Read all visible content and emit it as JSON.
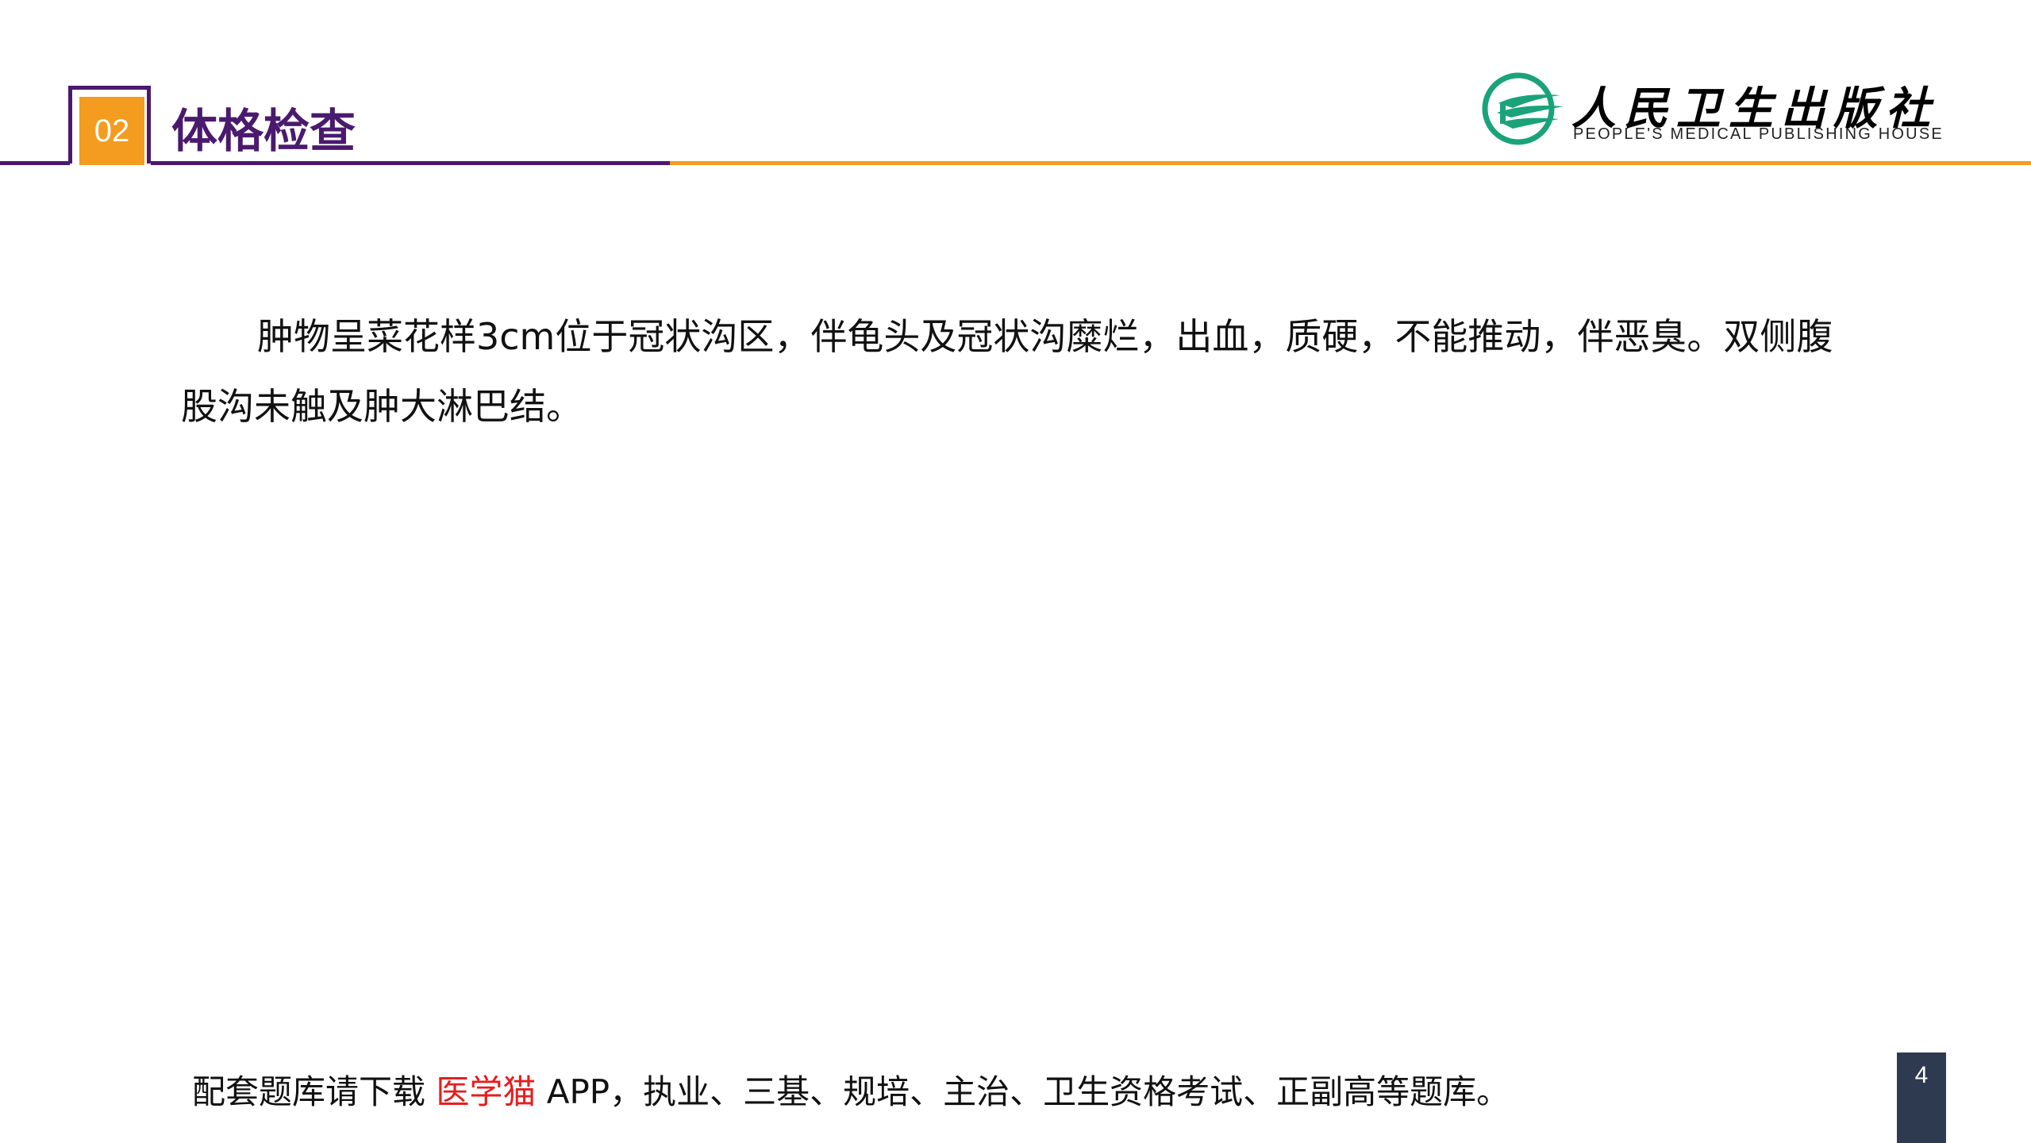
{
  "header": {
    "section_number": "02",
    "section_title": "体格检查"
  },
  "logo": {
    "name_cn": "人民卫生出版社",
    "name_en": "PEOPLE'S MEDICAL PUBLISHING HOUSE"
  },
  "content": {
    "paragraph": "肿物呈菜花样3cm位于冠状沟区，伴龟头及冠状沟糜烂，出血，质硬，不能推动，伴恶臭。双侧腹股沟未触及肿大淋巴结。"
  },
  "footer": {
    "prefix": "配套题库请下载 ",
    "brand": "医学猫",
    "suffix": " APP，执业、三基、规培、主治、卫生资格考试、正副高等题库。"
  },
  "page": {
    "number": "4"
  },
  "colors": {
    "purple": "#4a1a6e",
    "orange": "#f39c1f",
    "logo_green": "#1aa37a",
    "brand_red": "#e61e1e",
    "page_badge": "#2e3a4f"
  }
}
